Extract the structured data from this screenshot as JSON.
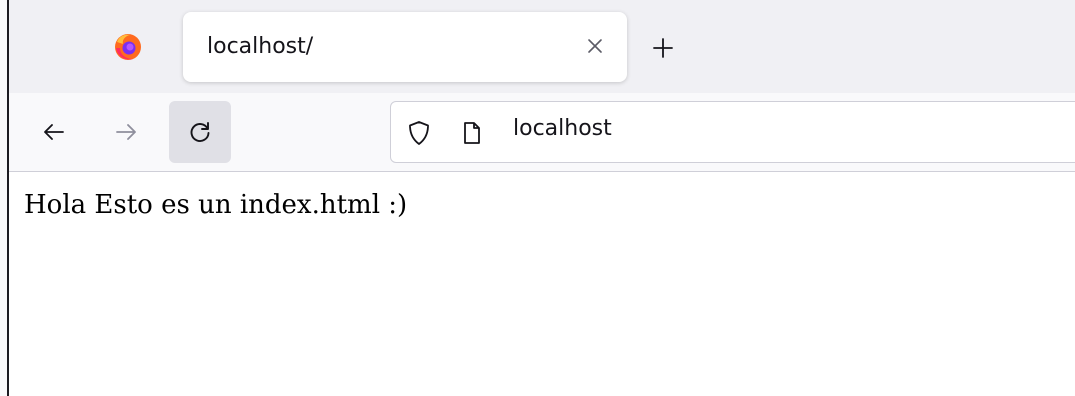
{
  "browser": {
    "logo_icon": "firefox-logo-icon",
    "tab": {
      "title": "localhost/",
      "close_icon": "close-icon"
    },
    "new_tab_icon": "plus-icon"
  },
  "navbar": {
    "back_icon": "arrow-left-icon",
    "forward_icon": "arrow-right-icon",
    "reload_icon": "reload-icon",
    "url": "localhost",
    "security_icon": "shield-icon",
    "page_icon": "page-icon"
  },
  "page": {
    "body_text": "Hola Esto es un index.html :)"
  },
  "colors": {
    "tabstrip_bg": "#f0f0f4",
    "navbar_bg": "#f9f9fb",
    "reload_hover_bg": "#e0e0e6",
    "text": "#15141a"
  }
}
